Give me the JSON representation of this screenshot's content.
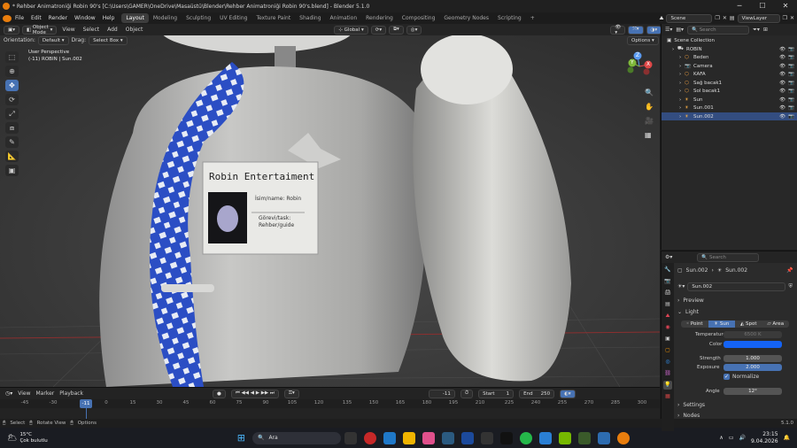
{
  "window": {
    "title": "* Rehber Animatroniği Robin 90's [C:\\Users\\GAMER\\OneDrive\\Masaüstü\\Blender\\Rehber Animatroniği Robin 90's.blend] - Blender 5.1.0"
  },
  "menu": [
    "File",
    "Edit",
    "Render",
    "Window",
    "Help"
  ],
  "workspaces": [
    "Layout",
    "Modeling",
    "Sculpting",
    "UV Editing",
    "Texture Paint",
    "Shading",
    "Animation",
    "Rendering",
    "Compositing",
    "Geometry Nodes",
    "Scripting"
  ],
  "workspace_add": "+",
  "scene": "Scene",
  "viewlayer": "ViewLayer",
  "viewport_header": {
    "mode": "Object Mode",
    "items": [
      "View",
      "Select",
      "Add",
      "Object"
    ],
    "transform": "Global"
  },
  "viewport_header2": {
    "orientation_label": "Orientation:",
    "orientation": "Default",
    "drag_label": "Drag:",
    "drag": "Select Box",
    "options": "Options"
  },
  "viewport_info": {
    "line1": "User Perspective",
    "line2": "(-11) ROBIN | Sun.002"
  },
  "badge": {
    "company": "Robin Entertaiment",
    "name_line": "İsim/name: Robin",
    "role_line1": "Görevi/task:",
    "role_line2": "Rehber/guide"
  },
  "gizmo": {
    "x": "X",
    "y": "Y",
    "z": "Z"
  },
  "outliner": {
    "search_placeholder": "Search",
    "root": "Scene Collection",
    "items": [
      {
        "name": "ROBIN",
        "indent": 0
      },
      {
        "name": "Beden",
        "indent": 1
      },
      {
        "name": "Camera",
        "indent": 1
      },
      {
        "name": "KAFA",
        "indent": 1
      },
      {
        "name": "Sağ bacak1",
        "indent": 1
      },
      {
        "name": "Sol bacak1",
        "indent": 1
      },
      {
        "name": "Sun",
        "indent": 1
      },
      {
        "name": "Sun.001",
        "indent": 1
      },
      {
        "name": "Sun.002",
        "indent": 1
      }
    ]
  },
  "properties": {
    "search_placeholder": "Search",
    "breadcrumb_obj": "Sun.002",
    "breadcrumb_data": "Sun.002",
    "datablock": "Sun.002",
    "preview": "Preview",
    "light": "Light",
    "light_types": [
      "Point",
      "Sun",
      "Spot",
      "Area"
    ],
    "active_type": "Sun",
    "temperature_label": "Temperature",
    "temperature": "6500 K",
    "color_label": "Color",
    "color": "#1463f5",
    "strength_label": "Strength",
    "strength": "1.000",
    "exposure_label": "Exposure",
    "exposure": "2.000",
    "normalize": "Normalize",
    "angle_label": "Angle",
    "angle": "12°",
    "settings": "Settings",
    "nodes": "Nodes"
  },
  "timeline": {
    "menu": [
      "View",
      "Marker",
      "Playback"
    ],
    "current": "-11",
    "start_label": "Start",
    "start": "1",
    "end_label": "End",
    "end": "250",
    "ticks": [
      "-45",
      "-30",
      "-11",
      "0",
      "15",
      "30",
      "45",
      "60",
      "75",
      "90",
      "105",
      "120",
      "135",
      "150",
      "165",
      "180",
      "195",
      "210",
      "225",
      "240",
      "255",
      "270",
      "285",
      "300"
    ]
  },
  "status": {
    "select": "Select",
    "rotate": "Rotate View",
    "options": "Options",
    "version": "5.1.0"
  },
  "taskbar": {
    "weather_temp": "15°C",
    "weather_desc": "Çok bulutlu",
    "search": "Ara",
    "time": "23:15",
    "date": "9.04.2026"
  }
}
